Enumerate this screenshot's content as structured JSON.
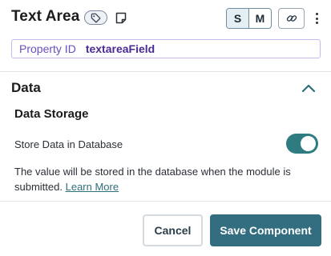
{
  "header": {
    "title": "Text Area",
    "icons": {
      "tag": "tag-icon",
      "note": "note-icon",
      "link": "link-icon",
      "more": "more-vertical-icon"
    },
    "size_options": [
      {
        "label": "S",
        "selected": true
      },
      {
        "label": "M",
        "selected": false
      }
    ]
  },
  "property": {
    "label": "Property ID",
    "value": "textareaField"
  },
  "section": {
    "title": "Data",
    "expanded": true,
    "subsection_title": "Data Storage",
    "toggle_label": "Store Data in Database",
    "toggle_on": true,
    "help_text": "The value will be stored in the database when the module is submitted.",
    "help_link": "Learn More"
  },
  "footer": {
    "cancel_label": "Cancel",
    "save_label": "Save Component"
  },
  "colors": {
    "accent": "#326d80",
    "toggle": "#2e7b80",
    "property_label": "#6b4fbb",
    "property_value": "#4a2a92"
  }
}
